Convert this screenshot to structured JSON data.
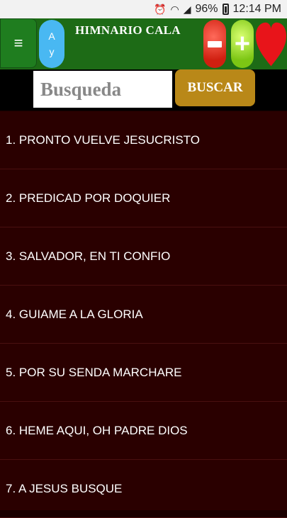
{
  "status_bar": {
    "battery": "96%",
    "time": "12:14 PM"
  },
  "header": {
    "menu_icon": "≡",
    "font_toggle": [
      "A",
      "y"
    ],
    "title": "HIMNARIO CALA"
  },
  "search": {
    "placeholder": "Busqueda",
    "value": "",
    "button_label": "BUSCAR"
  },
  "hymns": [
    "1. PRONTO VUELVE JESUCRISTO",
    "2. PREDICAD POR DOQUIER",
    "3. SALVADOR, EN TI CONFIO",
    "4. GUIAME A LA GLORIA",
    "5. POR SU SENDA MARCHARE",
    "6. HEME AQUI, OH PADRE DIOS",
    "7. A JESUS BUSQUE"
  ],
  "colors": {
    "header_green": "#1d6b16",
    "list_background": "#2a0000",
    "search_button": "#b98818",
    "font_button": "#49b8f2",
    "heart": "#e8141a"
  }
}
